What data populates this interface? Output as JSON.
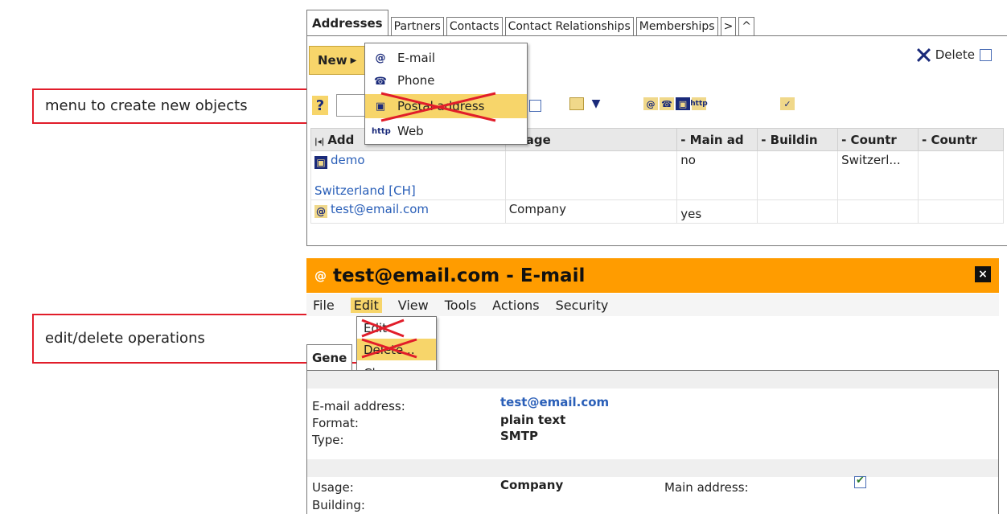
{
  "annotations": {
    "create": "menu to create new objects",
    "edit": "edit/delete operations"
  },
  "tabs": [
    "Addresses",
    "Partners",
    "Contacts",
    "Contact Relationships",
    "Memberships",
    ">",
    "^"
  ],
  "addresses_panel": {
    "new_button": "New",
    "delete_label": "Delete",
    "help_icon": "?",
    "columns": [
      "Add",
      "Usage",
      "- Main ad",
      "- Buildin",
      "- Countr",
      "- Countr"
    ],
    "rows": [
      {
        "icon": "postal-address-icon",
        "address": "demo",
        "address_line2": "Switzerland [CH]",
        "usage": "",
        "main": "no",
        "building": "",
        "country": "Switzerl...",
        "country2": ""
      },
      {
        "icon": "email-icon",
        "address": "test@email.com",
        "address_line2": "",
        "usage": "Company",
        "main": "yes",
        "building": "",
        "country": "",
        "country2": ""
      }
    ]
  },
  "new_menu": {
    "items": [
      {
        "label": "E-mail",
        "icon": "@"
      },
      {
        "label": "Phone",
        "icon": "☎"
      },
      {
        "label": "Postal address",
        "icon": "▣"
      },
      {
        "label": "Web",
        "icon": "http"
      }
    ]
  },
  "email_window": {
    "title": "test@email.com - E-mail",
    "menus": [
      "File",
      "Edit",
      "View",
      "Tools",
      "Actions",
      "Security"
    ],
    "edit_menu": [
      "Edit",
      "Delete...",
      "Clone..."
    ],
    "tabs": [
      "Gene",
      "n",
      "*"
    ],
    "fields": {
      "email_label": "E-mail address:",
      "email_value": "test@email.com",
      "format_label": "Format:",
      "format_value": "plain text",
      "type_label": "Type:",
      "type_value": "SMTP",
      "usage_label": "Usage:",
      "usage_value": "Company",
      "building_label": "Building:",
      "main_label": "Main address:"
    }
  },
  "colors": {
    "accent_orange": "#ff9c00",
    "highlight_yellow": "#f7d56a",
    "link_blue": "#2a5fb8",
    "annotation_red": "#e11d2a"
  }
}
